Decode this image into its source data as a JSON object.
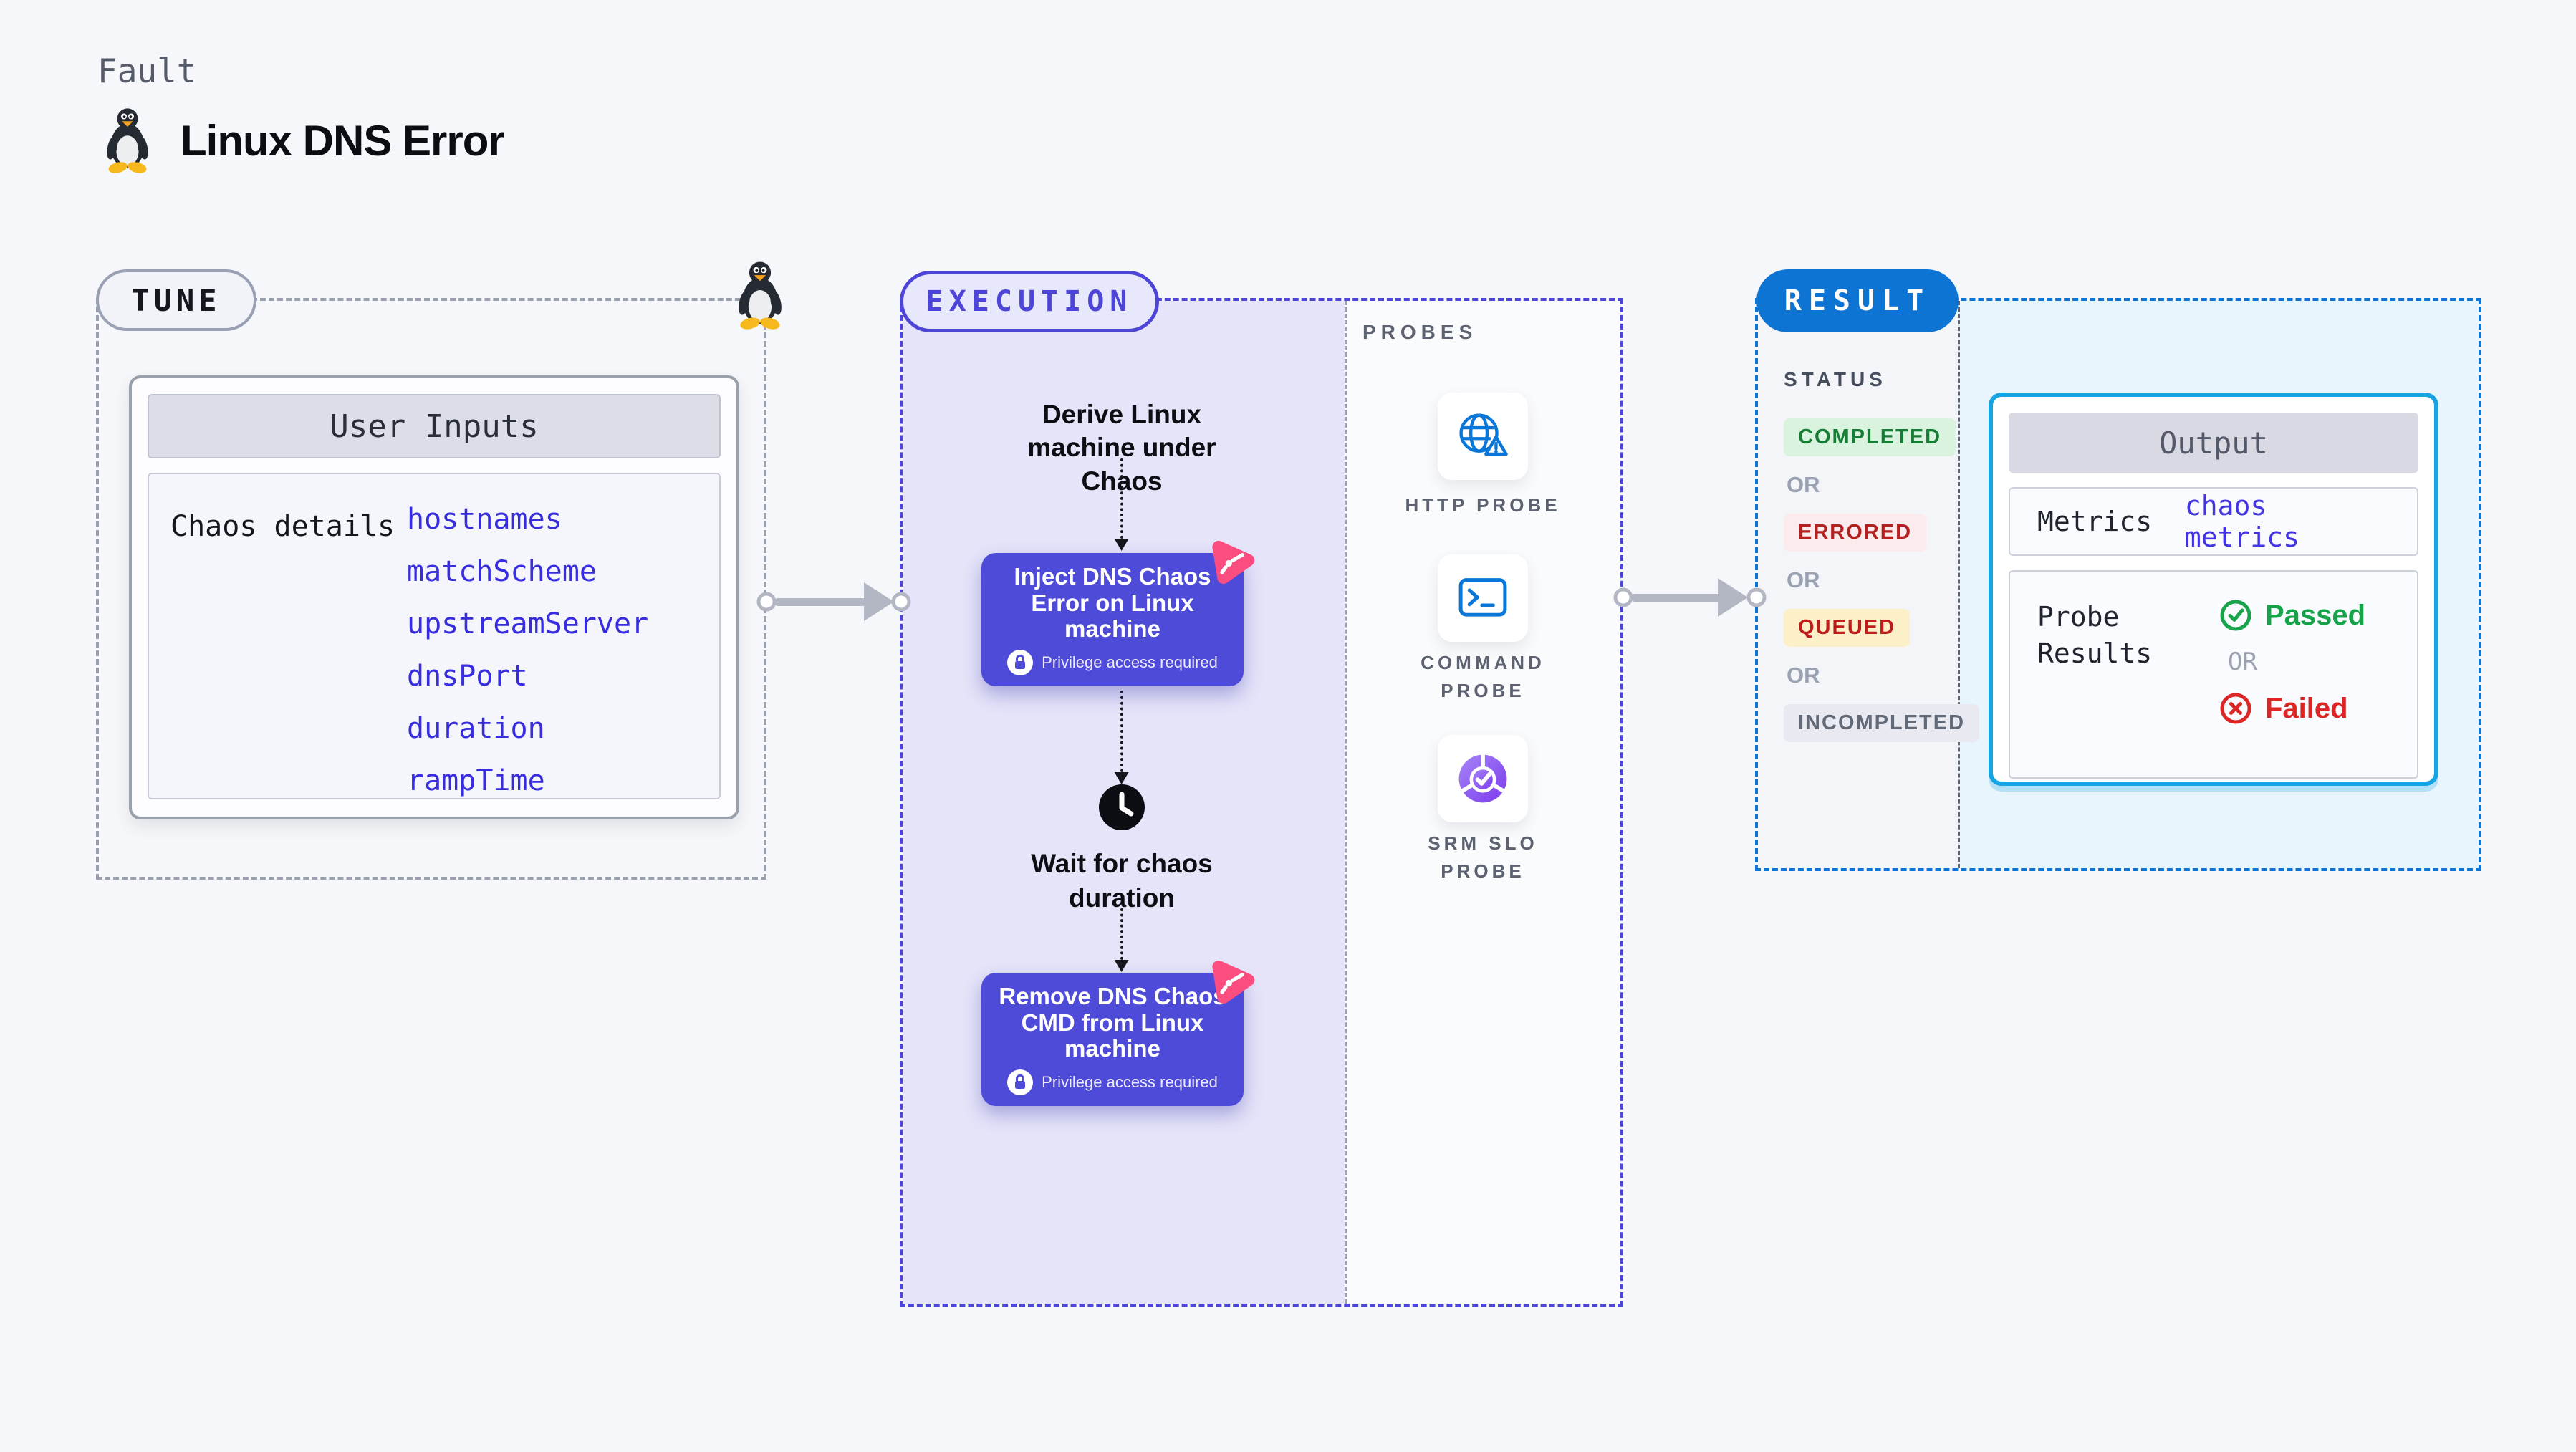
{
  "header": {
    "eyebrow": "Fault",
    "title": "Linux DNS Error"
  },
  "tune": {
    "badge": "TUNE",
    "table": {
      "header": "User Inputs",
      "row_label": "Chaos details",
      "inputs": [
        "hostnames",
        "matchScheme",
        "upstreamServer",
        "dnsPort",
        "duration",
        "rampTime"
      ]
    }
  },
  "execution": {
    "badge": "EXECUTION",
    "derive_label": "Derive Linux machine under Chaos",
    "inject": {
      "title": "Inject DNS Chaos Error on Linux machine",
      "note": "Privilege access required"
    },
    "wait_label": "Wait for chaos duration",
    "remove": {
      "title": "Remove DNS Chaos CMD from Linux machine",
      "note": "Privilege access required"
    },
    "probes": {
      "label": "PROBES",
      "items": [
        {
          "name": "HTTP PROBE",
          "icon": "globe-warning-icon"
        },
        {
          "name": "COMMAND PROBE",
          "icon": "terminal-icon"
        },
        {
          "name": "SRM SLO PROBE",
          "icon": "donut-check-icon"
        }
      ]
    }
  },
  "result": {
    "badge": "RESULT",
    "status": {
      "label": "STATUS",
      "separator": "OR",
      "values": [
        "COMPLETED",
        "ERRORED",
        "QUEUED",
        "INCOMPLETED"
      ]
    },
    "output": {
      "header": "Output",
      "metrics_label": "Metrics",
      "metrics_value": "chaos metrics",
      "probe_results_label": "Probe Results",
      "passed": "Passed",
      "or": "OR",
      "failed": "Failed"
    }
  },
  "colors": {
    "node_indigo": "#4f4bd9",
    "execution_accent": "#4d44d8",
    "result_accent": "#0e74d4",
    "output_border": "#16a5e2",
    "chaos_logo_pink": "#fb4d7f",
    "passed_green": "#16a34a",
    "failed_red": "#dc2626",
    "input_link_blue": "#372ddf"
  }
}
